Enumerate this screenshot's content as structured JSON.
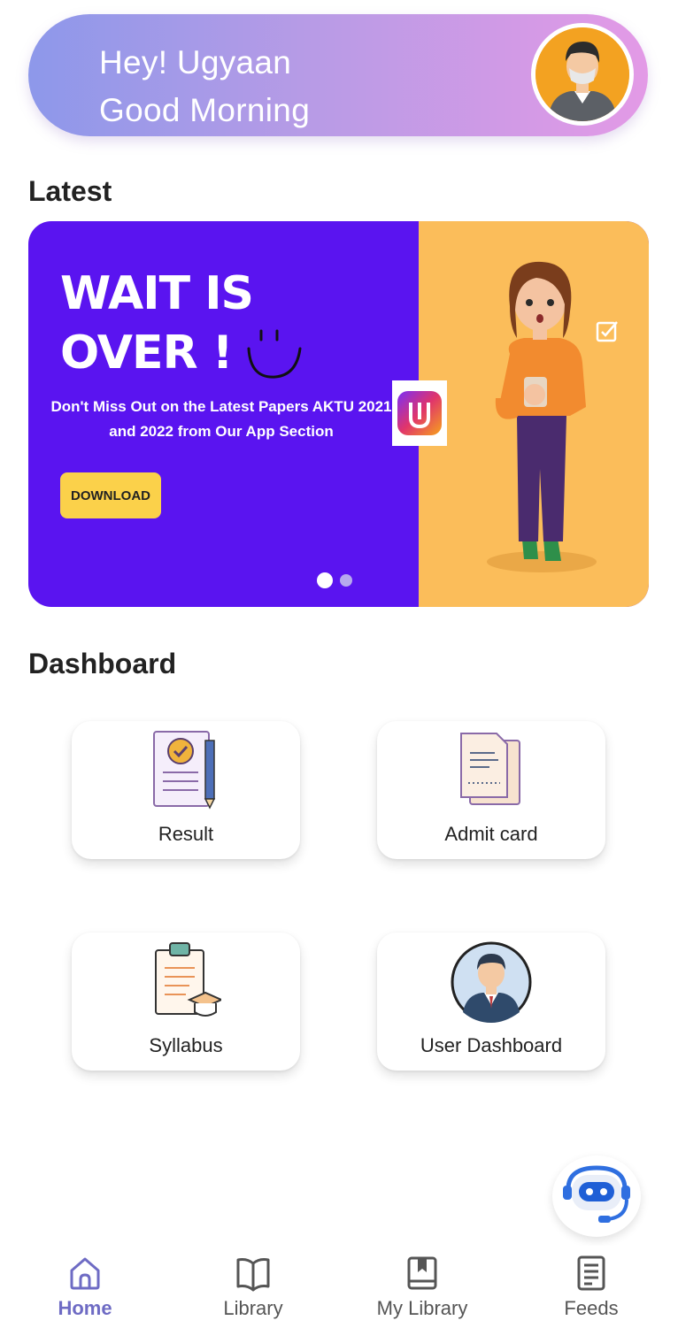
{
  "greeting": {
    "line1": "Hey! Ugyaan",
    "line2": "Good Morning",
    "avatar_icon": "user-avatar-icon"
  },
  "latest": {
    "title": "Latest",
    "banner": {
      "headline_line1": "WAIT IS",
      "headline_line2": "OVER !",
      "subtext_line1": "Don't  Miss Out on the Latest Papers AKTU 2021",
      "subtext_line2": "and 2022 from Our App  Section",
      "download_label": "DOWNLOAD",
      "primary_color": "#5a14f0",
      "secondary_color": "#fbbd5a",
      "active_slide": 1,
      "slide_count": 2
    }
  },
  "dashboard": {
    "title": "Dashboard",
    "cards": [
      {
        "label": "Result",
        "icon": "result-document-icon"
      },
      {
        "label": "Admit card",
        "icon": "admit-card-icon"
      },
      {
        "label": "Syllabus",
        "icon": "syllabus-clipboard-icon"
      },
      {
        "label": "User Dashboard",
        "icon": "user-profile-icon"
      }
    ]
  },
  "chatbot": {
    "icon": "chatbot-icon"
  },
  "bottom_nav": {
    "active_color": "#6e6bc4",
    "items": [
      {
        "label": "Home",
        "icon": "home-icon",
        "active": true
      },
      {
        "label": "Library",
        "icon": "book-icon",
        "active": false
      },
      {
        "label": "My Library",
        "icon": "bookmark-book-icon",
        "active": false
      },
      {
        "label": "Feeds",
        "icon": "feeds-document-icon",
        "active": false
      }
    ]
  }
}
